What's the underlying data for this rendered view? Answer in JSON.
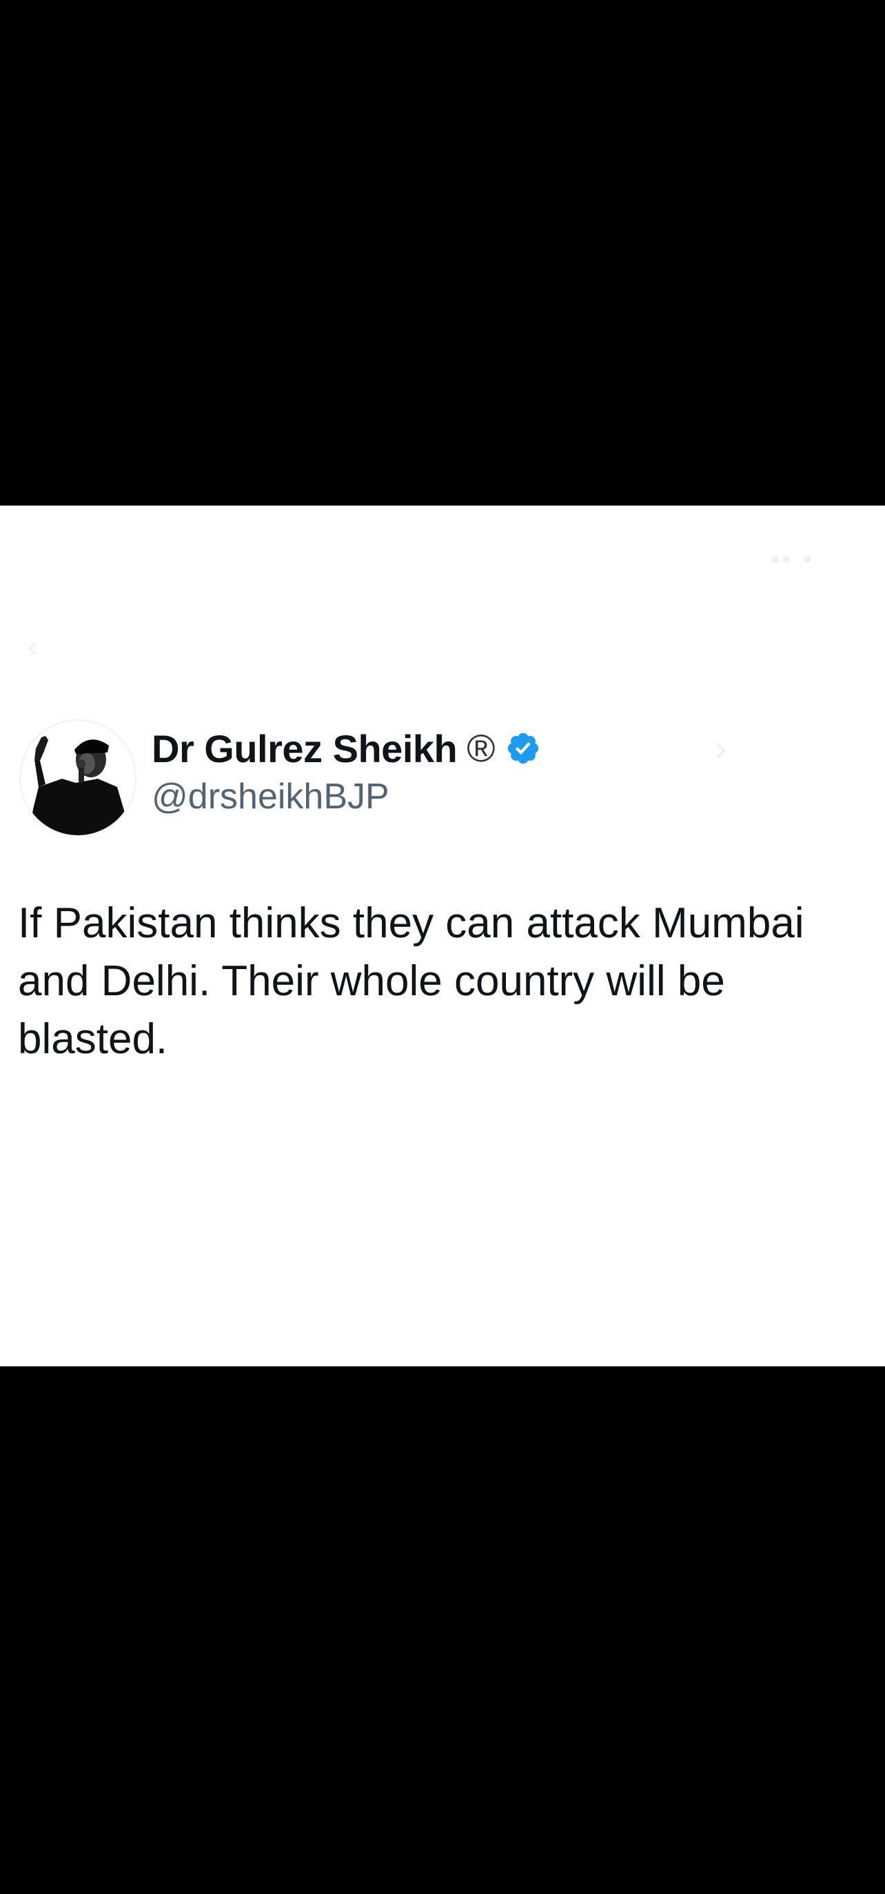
{
  "tweet": {
    "author": {
      "display_name": "Dr Gulrez Sheikh",
      "registered_mark": "®",
      "verified": true,
      "handle": "@drsheikhBJP"
    },
    "text": "If Pakistan thinks they can attack Mumbai and Delhi. Their whole country will be blasted."
  },
  "colors": {
    "background": "#000000",
    "card": "#ffffff",
    "name_text": "#0f1419",
    "handle_text": "#536471",
    "verified_badge": "#1d9bf0"
  },
  "icons": {
    "verified": "verified-badge-icon",
    "avatar": "profile-photo"
  }
}
